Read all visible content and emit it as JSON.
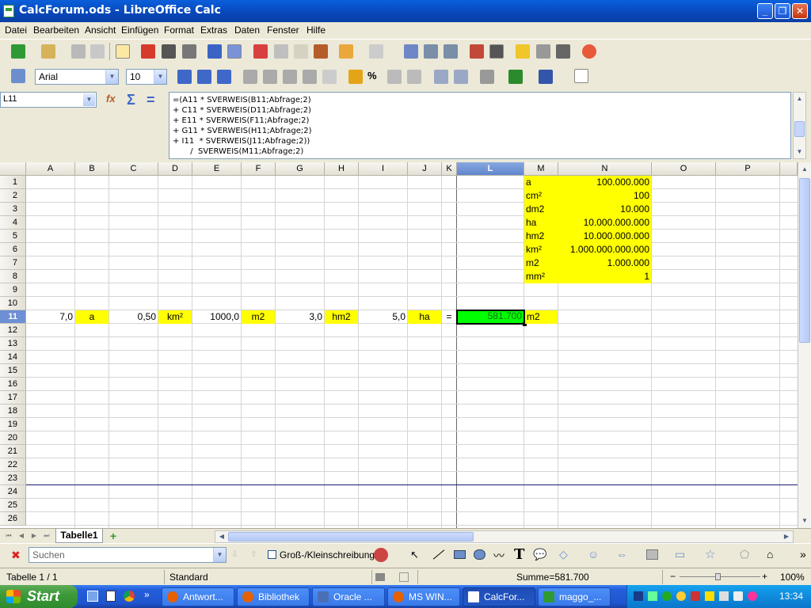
{
  "window": {
    "title": "CalcForum.ods - LibreOffice Calc"
  },
  "menu": [
    "Datei",
    "Bearbeiten",
    "Ansicht",
    "Einfügen",
    "Format",
    "Extras",
    "Daten",
    "Fenster",
    "Hilfe"
  ],
  "formatting": {
    "font_name": "Arial",
    "font_size": "10"
  },
  "formula_bar": {
    "cell_ref": "L11",
    "formula_lines": [
      "=(A11 * SVERWEIS(B11;Abfrage;2)",
      "+ C11 * SVERWEIS(D11;Abfrage;2)",
      "+ E11 * SVERWEIS(F11;Abfrage;2)",
      "+ G11 * SVERWEIS(H11;Abfrage;2)",
      "+ I11  * SVERWEIS(J11;Abfrage;2))",
      "       /  SVERWEIS(M11;Abfrage;2)"
    ]
  },
  "sheet": {
    "columns": [
      "A",
      "B",
      "C",
      "D",
      "E",
      "F",
      "G",
      "H",
      "I",
      "J",
      "K",
      "L",
      "M",
      "N",
      "O",
      "P"
    ],
    "rows": [
      "1",
      "2",
      "3",
      "4",
      "5",
      "6",
      "7",
      "8",
      "9",
      "10",
      "11",
      "12",
      "13",
      "14",
      "15",
      "16",
      "17",
      "18",
      "19",
      "20",
      "21",
      "22",
      "23",
      "24",
      "25",
      "26"
    ],
    "active_col": "L",
    "active_row": "11",
    "lookup_table": [
      {
        "unit": "a",
        "value": "100.000.000"
      },
      {
        "unit": "cm²",
        "value": "100"
      },
      {
        "unit": "dm2",
        "value": "10.000"
      },
      {
        "unit": "ha",
        "value": "10.000.000.000"
      },
      {
        "unit": "hm2",
        "value": "10.000.000.000"
      },
      {
        "unit": "km²",
        "value": "1.000.000.000.000"
      },
      {
        "unit": "m2",
        "value": "1.000.000"
      },
      {
        "unit": "mm²",
        "value": "1"
      }
    ],
    "row11": {
      "A": "7,0",
      "B": "a",
      "C": "0,50",
      "D": "km²",
      "E": "1000,0",
      "F": "m2",
      "G": "3,0",
      "H": "hm2",
      "I": "5,0",
      "J": "ha",
      "K": "=",
      "L": "581.700",
      "M": "m2"
    }
  },
  "tabs": {
    "sheet_name": "Tabelle1"
  },
  "findbar": {
    "search_placeholder": "Suchen",
    "match_case_label": "Groß-/Kleinschreibung"
  },
  "status": {
    "sheet_info": "Tabelle 1 / 1",
    "style": "Standard",
    "sum": "Summe=581.700",
    "zoom": "100%"
  },
  "taskbar": {
    "start_label": "Start",
    "tasks": [
      "Antwort...",
      "Bibliothek",
      "Oracle ...",
      "MS WIN...",
      "CalcFor...",
      "maggo_..."
    ],
    "clock": "13:34"
  },
  "colors": {
    "highlight": "#ffff00",
    "result_cell": "#00ff00",
    "title_bar": "#0a5fdb"
  }
}
